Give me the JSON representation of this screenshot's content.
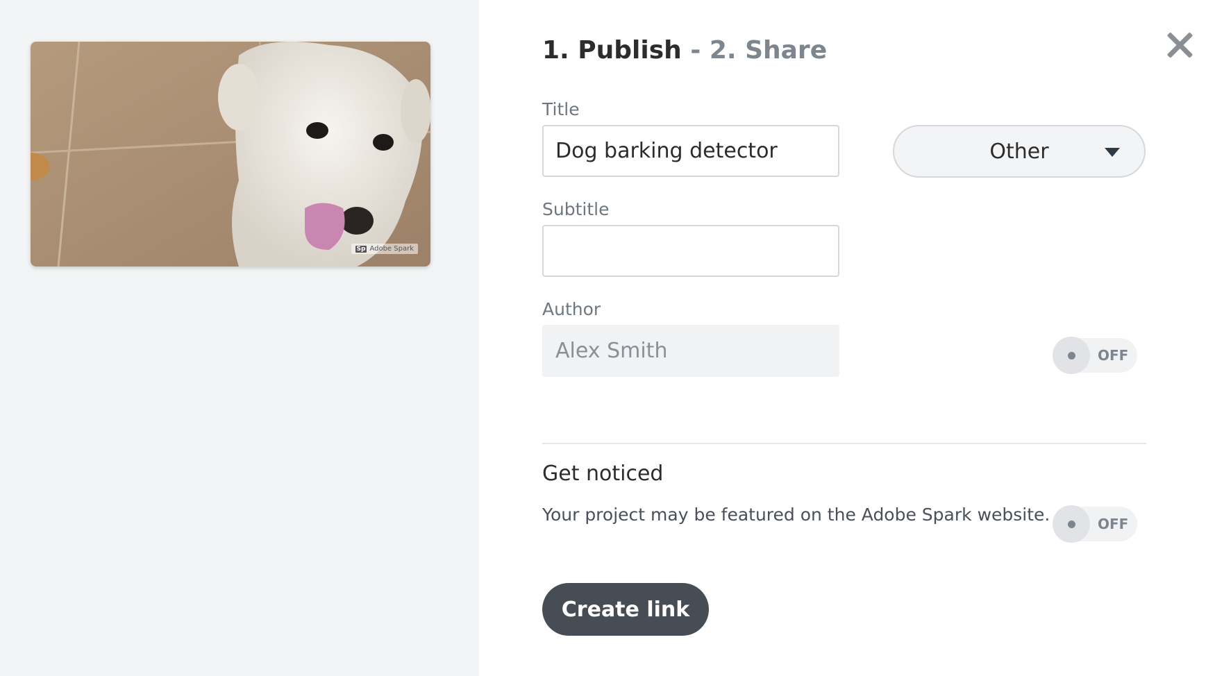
{
  "preview": {
    "watermark_badge": "Sp",
    "watermark_text": "Adobe Spark"
  },
  "header": {
    "step1": "1. Publish",
    "separator": "-",
    "step2": "2. Share",
    "close_icon": "close-icon"
  },
  "form": {
    "title_label": "Title",
    "title_value": "Dog barking detector",
    "category_value": "Other",
    "subtitle_label": "Subtitle",
    "subtitle_value": "",
    "author_label": "Author",
    "author_value": "Alex Smith",
    "author_toggle_state": "OFF"
  },
  "get_noticed": {
    "title": "Get noticed",
    "description": "Your project may be featured on the Adobe Spark website.",
    "toggle_state": "OFF"
  },
  "actions": {
    "create_link_label": "Create link"
  },
  "colors": {
    "left_panel_bg": "#f3f4f5",
    "primary_button": "#474d55",
    "muted_text": "#7d868e"
  }
}
